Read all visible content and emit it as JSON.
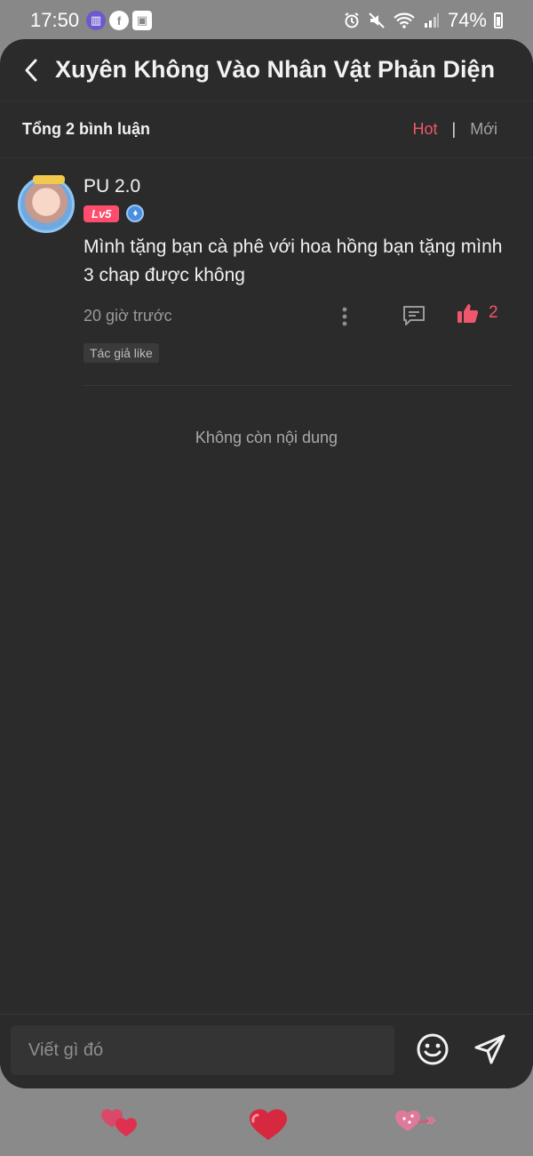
{
  "status_bar": {
    "time": "17:50",
    "battery": "74%",
    "icons": [
      "photo-app-icon",
      "facebook-icon",
      "gallery-icon",
      "alarm-icon",
      "mute-icon",
      "wifi-icon",
      "signal-icon",
      "battery-icon"
    ]
  },
  "header": {
    "back_icon": "chevron-left-icon",
    "title": "Xuyên Không Vào Nhân Vật Phản Diện"
  },
  "summary": {
    "total": "Tổng 2 bình luận",
    "tabs": {
      "hot": "Hot",
      "separator": "|",
      "new": "Mới"
    },
    "active_tab": "Hot"
  },
  "comments": [
    {
      "username": "PU 2.0",
      "level": "Lv5",
      "text": "Mình tặng bạn cà phê với hoa hồng bạn tặng mình 3 chap được không",
      "timestamp": "20 giờ trước",
      "likes": "2",
      "tag": "Tác giả like"
    }
  ],
  "end_message": "Không còn nội dung",
  "composer": {
    "placeholder": "Viết gì đó",
    "emoji_icon": "smiley-icon",
    "send_icon": "send-icon"
  },
  "reactions": [
    "double-heart-icon",
    "heart-icon",
    "heart-lollipop-icon"
  ],
  "colors": {
    "accent": "#f0566c",
    "sheet_bg": "#2b2b2b",
    "level_badge": "#ff4d6d"
  }
}
